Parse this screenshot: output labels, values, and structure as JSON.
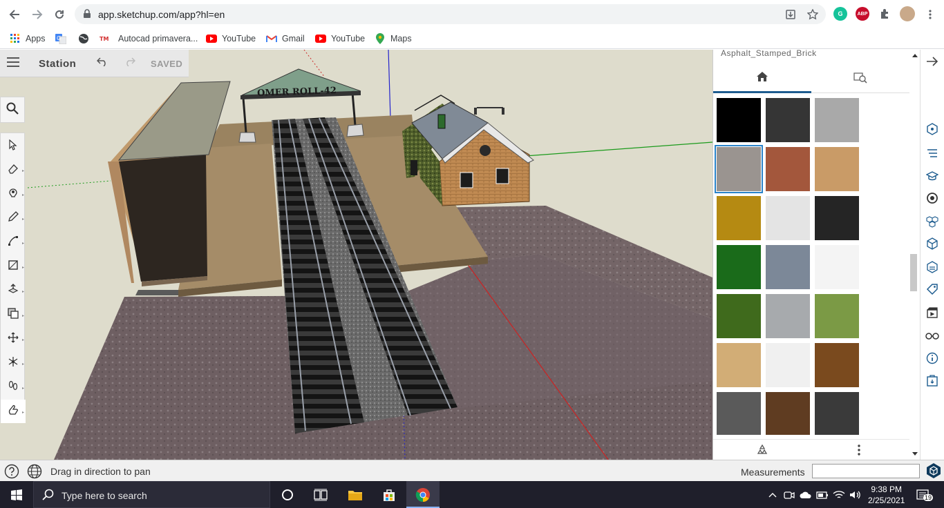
{
  "browser": {
    "url": "app.sketchup.com/app?hl=en",
    "bookmarks": [
      "Apps",
      "",
      "Autocad primavera...",
      "YouTube",
      "Gmail",
      "YouTube",
      "Maps"
    ],
    "ext_abp": "ABP"
  },
  "app": {
    "doc_title": "Station",
    "saved_label": "SAVED",
    "sign_text": "OMER ROLL-42"
  },
  "materials": {
    "current_name": "Asphalt_Stamped_Brick",
    "tab_home_icon": "home-icon",
    "tab_search_icon": "image-search-icon",
    "swatch_colors": [
      "#000000",
      "#353535",
      "#a9a9a9",
      "#9a9490",
      "#a3573c",
      "#c99b67",
      "#b58a12",
      "#e4e4e4",
      "#252525",
      "#1a6b1a",
      "#7c8898",
      "#f4f4f4",
      "#3f6a1c",
      "#a7aaad",
      "#7b9a45",
      "#d2ad76",
      "#f0f0f0",
      "#7a4a1e",
      "#5a5a5a",
      "#5f3c21",
      "#3a3a3a"
    ]
  },
  "status": {
    "hint": "Drag in direction to pan",
    "measurements_label": "Measurements",
    "measurements_value": ""
  },
  "taskbar": {
    "search_placeholder": "Type here to search",
    "time": "9:38 PM",
    "date": "2/25/2021",
    "notification_count": "19"
  }
}
